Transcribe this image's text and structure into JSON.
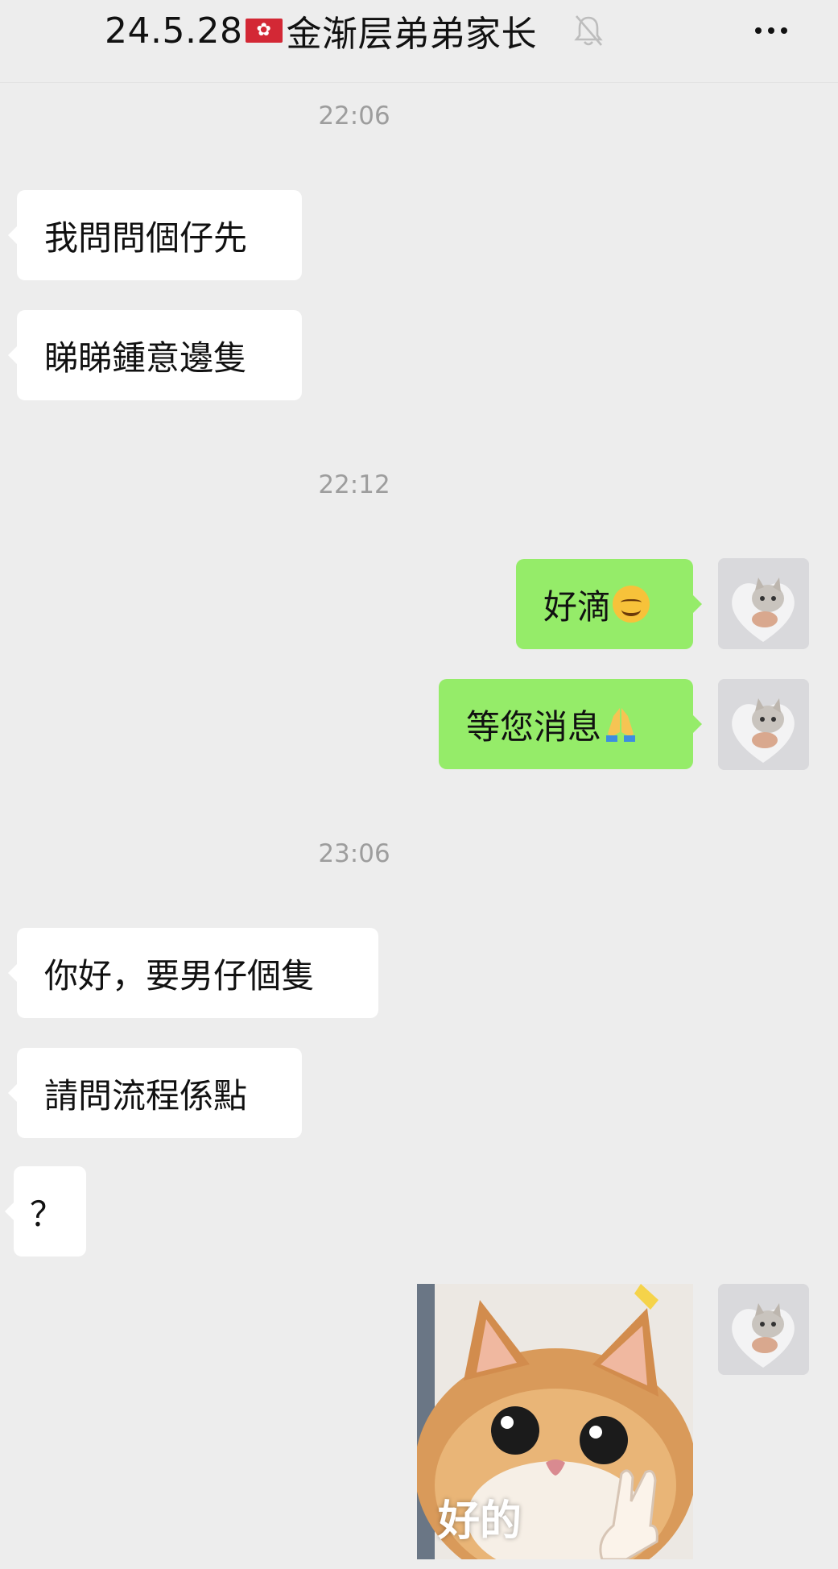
{
  "header": {
    "title_prefix": "24.5.28",
    "title_name": "金渐层弟弟家长",
    "flag_icon": "hong-kong-flag-icon",
    "mute_icon": "bell-off-icon",
    "more_icon": "more-dots-icon"
  },
  "messages": {
    "time_1": "22:06",
    "in_1": "我問問個仔先",
    "in_2": "睇睇鍾意邊隻",
    "time_2": "22:12",
    "out_1": "好滴",
    "out_2": "等您消息",
    "time_3": "23:06",
    "in_3": "你好，要男仔個隻",
    "in_4": "請問流程係點",
    "in_5": "？",
    "sticker_caption": "好的"
  },
  "colors": {
    "background": "#ededed",
    "incoming_bubble": "#ffffff",
    "outgoing_bubble": "#95ec69",
    "timestamp": "#9d9d9d"
  }
}
